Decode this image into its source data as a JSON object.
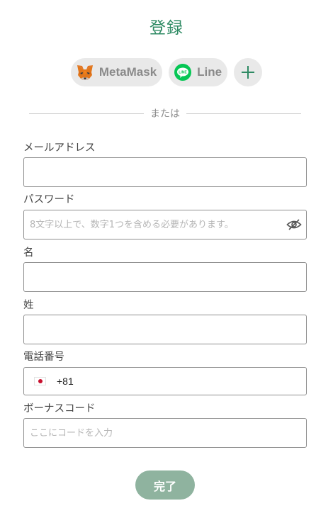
{
  "title": "登録",
  "social": {
    "metamask_label": "MetaMask",
    "line_label": "Line",
    "more_icon": "plus-icon"
  },
  "divider_text": "または",
  "form": {
    "email": {
      "label": "メールアドレス",
      "value": "",
      "placeholder": ""
    },
    "password": {
      "label": "パスワード",
      "value": "",
      "placeholder": "8文字以上で、数字1つを含める必要があります。",
      "icon": "eye-off-icon"
    },
    "first_name": {
      "label": "名",
      "value": "",
      "placeholder": ""
    },
    "last_name": {
      "label": "姓",
      "value": "",
      "placeholder": ""
    },
    "phone": {
      "label": "電話番号",
      "country_flag": "japan-flag",
      "dial_code": "+81",
      "value": "",
      "placeholder": ""
    },
    "bonus_code": {
      "label": "ボーナスコード",
      "value": "",
      "placeholder": "ここにコードを入力"
    }
  },
  "submit_label": "完了",
  "colors": {
    "accent": "#2e8a63",
    "submit_bg": "#8fb39f",
    "chip_bg": "#e9e9e9",
    "line_green": "#06c755",
    "metamask_orange": "#e2761b"
  }
}
